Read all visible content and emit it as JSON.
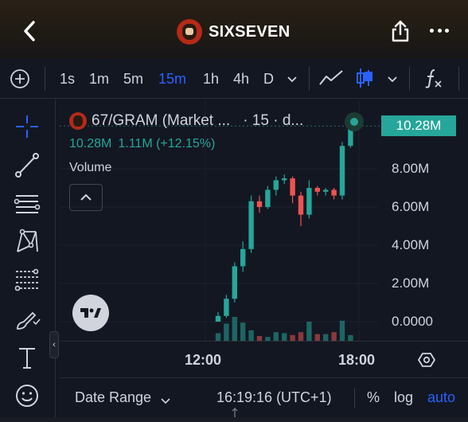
{
  "header": {
    "title": "SIXSEVEN"
  },
  "toolbar": {
    "intervals": [
      "1s",
      "1m",
      "5m",
      "15m",
      "1h",
      "4h",
      "D"
    ],
    "active_interval": "15m"
  },
  "legend": {
    "symbol": "67/GRAM (Market ...",
    "suffix": "· 15 · d...",
    "last_price": "10.28M",
    "change": "1.11M (+12.15%)",
    "volume_label": "Volume"
  },
  "price_tag": "10.28M",
  "price_axis": [
    "8.00M",
    "6.00M",
    "4.00M",
    "2.00M",
    "0.0000"
  ],
  "time_axis": [
    "12:00",
    "18:00"
  ],
  "bottom_bar": {
    "date_range": "Date Range",
    "clock": "16:19:16 (UTC+1)",
    "percent": "%",
    "log": "log",
    "auto": "auto"
  },
  "colors": {
    "up": "#26a69a",
    "down": "#ef5350",
    "accent": "#2962ff",
    "background": "#131722"
  },
  "chart_data": {
    "type": "candlestick",
    "ylabel": "",
    "ylim": [
      0,
      10.28
    ],
    "y_unit": "M",
    "x_ticks": [
      "12:00",
      "18:00"
    ],
    "candles": [
      {
        "open": 0.0,
        "high": 0.5,
        "low": 0.0,
        "close": 0.3
      },
      {
        "open": 0.3,
        "high": 1.4,
        "low": 0.2,
        "close": 1.2
      },
      {
        "open": 1.2,
        "high": 3.1,
        "low": 1.0,
        "close": 2.9
      },
      {
        "open": 2.9,
        "high": 4.2,
        "low": 2.6,
        "close": 3.8
      },
      {
        "open": 3.8,
        "high": 6.6,
        "low": 3.6,
        "close": 6.3
      },
      {
        "open": 6.3,
        "high": 6.6,
        "low": 5.7,
        "close": 6.0
      },
      {
        "open": 6.0,
        "high": 7.1,
        "low": 5.9,
        "close": 6.9
      },
      {
        "open": 6.9,
        "high": 7.6,
        "low": 6.6,
        "close": 7.4
      },
      {
        "open": 7.4,
        "high": 7.7,
        "low": 7.2,
        "close": 7.5
      },
      {
        "open": 7.5,
        "high": 7.6,
        "low": 6.2,
        "close": 6.6
      },
      {
        "open": 6.6,
        "high": 6.8,
        "low": 5.0,
        "close": 5.6
      },
      {
        "open": 5.6,
        "high": 7.4,
        "low": 5.4,
        "close": 7.0
      },
      {
        "open": 7.0,
        "high": 7.1,
        "low": 6.6,
        "close": 6.8
      },
      {
        "open": 6.8,
        "high": 7.0,
        "low": 6.6,
        "close": 6.9
      },
      {
        "open": 6.9,
        "high": 7.0,
        "low": 6.4,
        "close": 6.6
      },
      {
        "open": 6.6,
        "high": 9.4,
        "low": 6.4,
        "close": 9.2
      },
      {
        "open": 9.2,
        "high": 10.3,
        "low": 9.1,
        "close": 10.28
      }
    ],
    "volume": [
      0.8,
      1.8,
      2.5,
      1.9,
      1.1,
      0.5,
      0.4,
      0.9,
      0.8,
      0.6,
      0.9,
      2.0,
      0.7,
      0.7,
      0.9,
      2.1,
      0.6
    ]
  }
}
